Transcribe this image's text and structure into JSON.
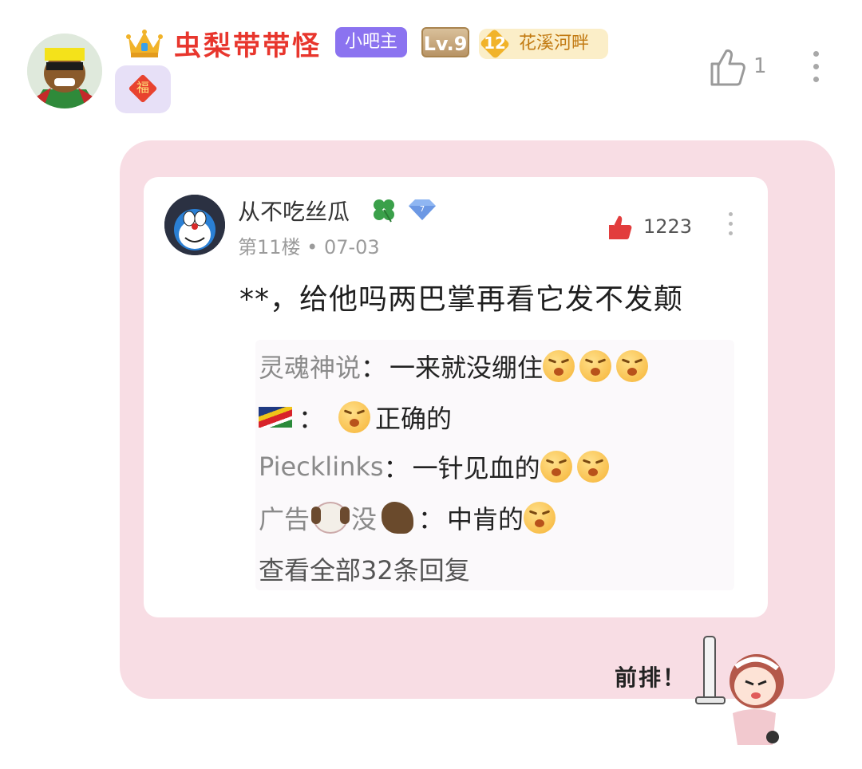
{
  "comment": {
    "username": "虫梨带带怪",
    "badge_owner": "小吧主",
    "badge_level": "Lv.9",
    "honor_level": "12",
    "honor_name": "花溪河畔",
    "fu_char": "福",
    "like_count": "1"
  },
  "quoted_post": {
    "username": "从不吃丝瓜",
    "meta": "第11楼 • 07-03",
    "like_count": "1223",
    "text": "**，给他吗两巴掌再看它发不发颠",
    "replies": [
      {
        "who": "灵魂神说",
        "text": "一来就没绷住"
      },
      {
        "who": "",
        "text": "正确的"
      },
      {
        "who": "Piecklinks",
        "text": "一针见血的"
      },
      {
        "who_part1": "广告",
        "who_part2": "没",
        "text": "中肯的"
      }
    ],
    "view_all": "查看全部32条回复"
  },
  "sticker": {
    "text": "前排！"
  },
  "colors": {
    "username": "#e8362d",
    "panel": "#f8dde4",
    "owner_badge": "#8b73f0"
  }
}
